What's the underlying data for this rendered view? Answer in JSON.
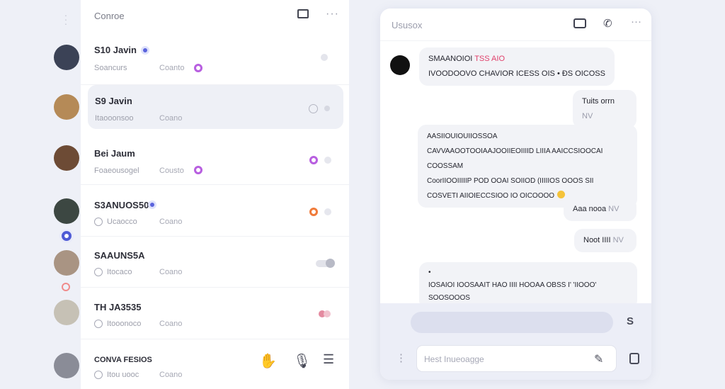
{
  "rail": {
    "avatars": [
      {
        "color": "#3b4256",
        "has_badge": false
      },
      {
        "color": "#b58a57",
        "has_badge": false
      },
      {
        "color": "#6d4b35",
        "has_badge": false
      },
      {
        "color": "#3c4742",
        "has_badge": true
      },
      {
        "color": "#a99483",
        "has_badge": false
      },
      {
        "color": "#c6c1b5",
        "has_badge": false
      },
      {
        "color": "#8a8c97",
        "has_badge": false
      }
    ]
  },
  "list": {
    "title": "Conroe",
    "more_label": "···",
    "conversations": [
      {
        "name": "S10 Javin",
        "sub": "Soancurs",
        "sub2": "Coanto",
        "dot": "#b85fe0",
        "active": false
      },
      {
        "name": "S9 Javin",
        "sub": "Itaooonsoo",
        "sub2": "Coano",
        "dot": "",
        "active": true
      },
      {
        "name": "Bei Jaum",
        "sub": "Foaeousogel",
        "sub2": "Cousto",
        "dot": "#b85fe0",
        "active": false
      },
      {
        "name": "S3ANUOS50",
        "sub": "Ucaocco",
        "sub2": "Coano",
        "dot": "#5a63dd",
        "active": false
      },
      {
        "name": "SAAUNS5A",
        "sub": "Itocaco",
        "sub2": "Coano",
        "dot": "",
        "active": false
      },
      {
        "name": "TH JA3535",
        "sub": "Itooonoco",
        "sub2": "Coano",
        "dot": "",
        "active": false
      },
      {
        "name": "CONVA FESIOS",
        "sub": "Itou uooc",
        "sub2": "Coano",
        "dot": "",
        "active": false
      }
    ],
    "bottom_icons": [
      "hand-icon",
      "mic-icon",
      "filter-icon"
    ]
  },
  "chat": {
    "title": "Ususox",
    "messages": [
      {
        "sender": "SMAANOIOI",
        "sender_tag": "TSS AIO",
        "text": "IVOODOOVO CHAVIOR ICESS OIS • ÐS OICOSS",
        "align": "left"
      },
      {
        "text": "Tuits orrn",
        "time": "NV",
        "align": "right"
      },
      {
        "lines": [
          "AASIIOUIOUIIOSSOA",
          "CAVVAAOOTOOIAAJOOIIEOIIIID LIIIA AAICCSIOOCAI COOSSAM",
          "CoorIIOOIIIIIP POD OOAI SOIIOD (IIIIIOS OOOS SII",
          "COSVETI AIIOIECCSIOO IO OICOOOO"
        ],
        "align": "right"
      },
      {
        "text": "Aaa nooa",
        "time": "NV",
        "align": "right"
      },
      {
        "text": "Noot IIII",
        "time": "NV",
        "align": "right"
      },
      {
        "lines": [
          "•",
          "IOSAIOI IOOSAAIT HAO IIII HOOAA OBSS I' 'IIOOO' SOOSOOOS"
        ],
        "align": "right"
      }
    ],
    "input": {
      "placeholder": "Hest Inueoagge"
    }
  }
}
